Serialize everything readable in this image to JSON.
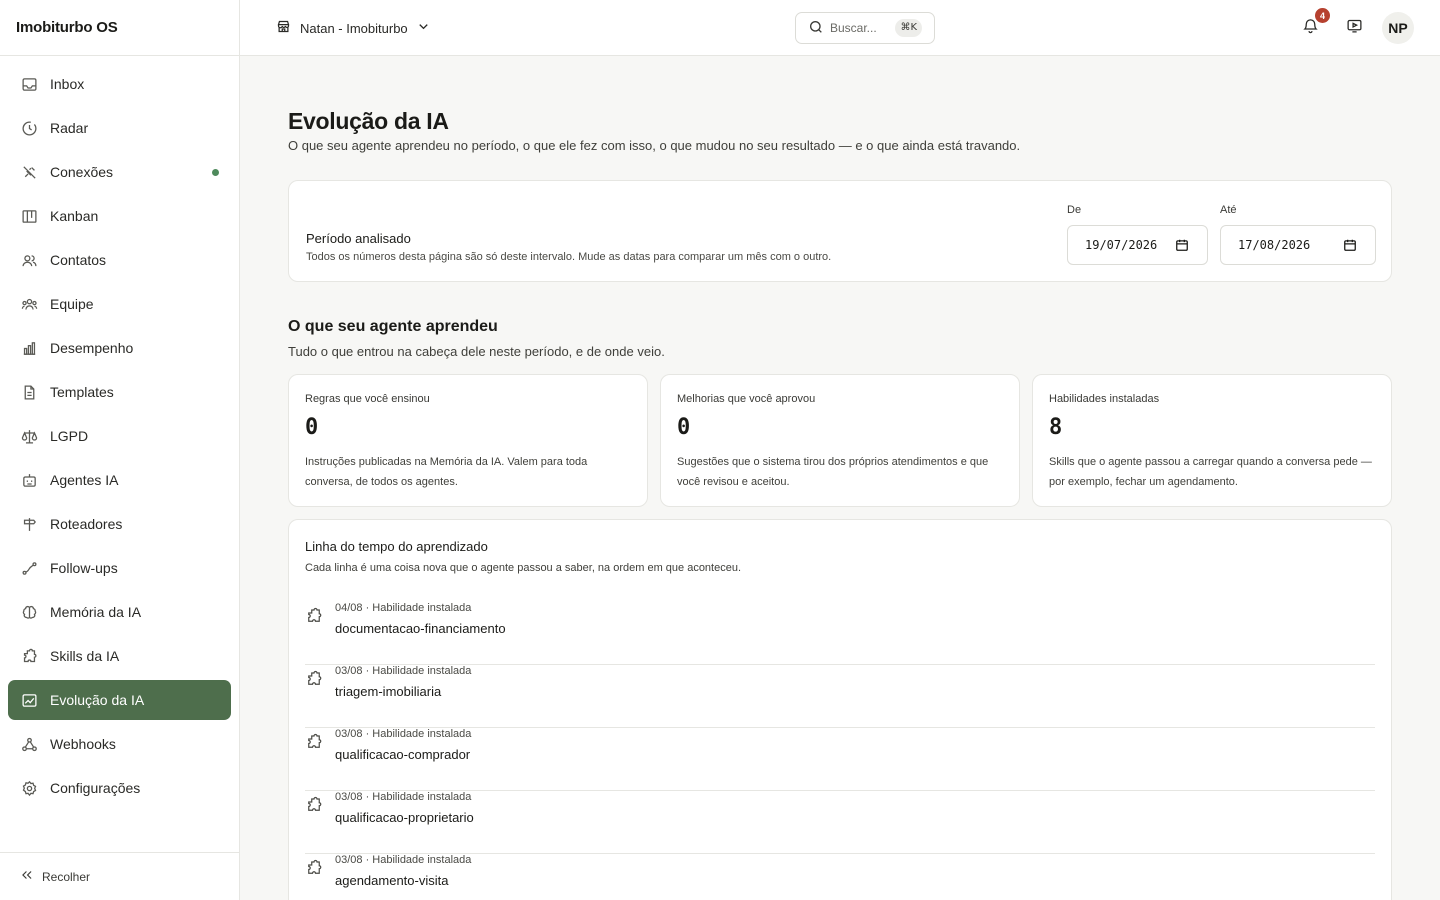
{
  "app": {
    "title": "Imobiturbo OS"
  },
  "sidebar": {
    "items": [
      {
        "label": "Inbox"
      },
      {
        "label": "Radar"
      },
      {
        "label": "Conexões"
      },
      {
        "label": "Kanban"
      },
      {
        "label": "Contatos"
      },
      {
        "label": "Equipe"
      },
      {
        "label": "Desempenho"
      },
      {
        "label": "Templates"
      },
      {
        "label": "LGPD"
      },
      {
        "label": "Agentes IA"
      },
      {
        "label": "Roteadores"
      },
      {
        "label": "Follow-ups"
      },
      {
        "label": "Memória da IA"
      },
      {
        "label": "Skills da IA"
      },
      {
        "label": "Evolução da IA"
      },
      {
        "label": "Webhooks"
      },
      {
        "label": "Configurações"
      }
    ],
    "active_item": "Evolução da IA",
    "collapse_label": "Recolher"
  },
  "header": {
    "workspace": "Natan - Imobiturbo",
    "search_placeholder": "Buscar...",
    "search_shortcut": "⌘K",
    "notifications_count": "4",
    "avatar_initials": "NP"
  },
  "page": {
    "title": "Evolução da IA",
    "subtitle": "O que seu agente aprendeu no período, o que ele fez com isso, o que mudou no seu resultado — e o que ainda está travando."
  },
  "period": {
    "title": "Período analisado",
    "description": "Todos os números desta página são só deste intervalo. Mude as datas para comparar um mês com o outro.",
    "from_label": "De",
    "from_value": "19/07/2026",
    "to_label": "Até",
    "to_value": "17/08/2026"
  },
  "learned": {
    "title": "O que seu agente aprendeu",
    "subtitle": "Tudo o que entrou na cabeça dele neste período, e de onde veio.",
    "stats": [
      {
        "label": "Regras que você ensinou",
        "value": "0",
        "description": "Instruções publicadas na Memória da IA. Valem para toda conversa, de todos os agentes."
      },
      {
        "label": "Melhorias que você aprovou",
        "value": "0",
        "description": "Sugestões que o sistema tirou dos próprios atendimentos e que você revisou e aceitou."
      },
      {
        "label": "Habilidades instaladas",
        "value": "8",
        "description": "Skills que o agente passou a carregar quando a conversa pede — por exemplo, fechar um agendamento."
      }
    ]
  },
  "timeline": {
    "title": "Linha do tempo do aprendizado",
    "subtitle": "Cada linha é uma coisa nova que o agente passou a saber, na ordem em que aconteceu.",
    "items": [
      {
        "meta": "04/08 · Habilidade instalada",
        "name": "documentacao-financiamento"
      },
      {
        "meta": "03/08 · Habilidade instalada",
        "name": "triagem-imobiliaria"
      },
      {
        "meta": "03/08 · Habilidade instalada",
        "name": "qualificacao-comprador"
      },
      {
        "meta": "03/08 · Habilidade instalada",
        "name": "qualificacao-proprietario"
      },
      {
        "meta": "03/08 · Habilidade instalada",
        "name": "agendamento-visita"
      }
    ]
  },
  "colors": {
    "accent": "#4e6e4c",
    "badge": "#b6412f",
    "status_dot": "#4e8a5c"
  }
}
